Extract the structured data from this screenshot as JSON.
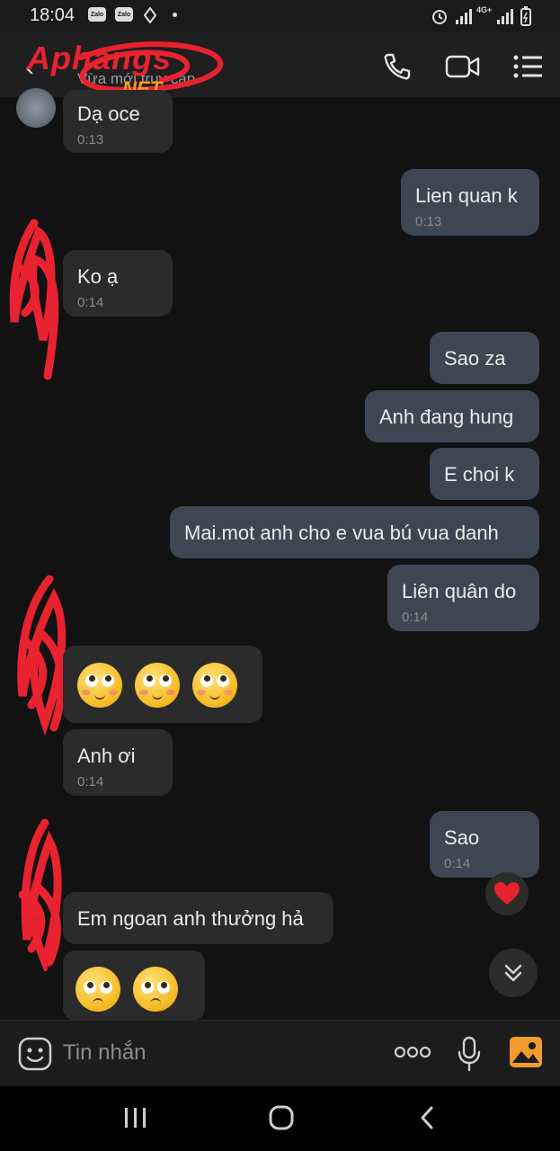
{
  "status_bar": {
    "time": "18:04",
    "zalo_badge": "Zalo",
    "network": "4G+"
  },
  "header": {
    "status_text": "Vừa mới truy cập",
    "watermark_main": "Aphangs",
    "watermark_sub": ".NET"
  },
  "messages": [
    {
      "side": "in",
      "text": "Dạ oce",
      "time": "0:13"
    },
    {
      "side": "out",
      "text": "Lien quan k",
      "time": "0:13"
    },
    {
      "side": "in",
      "text": "Ko ạ",
      "time": "0:14"
    },
    {
      "side": "out",
      "text": "Sao za",
      "time": ""
    },
    {
      "side": "out",
      "text": "Anh đang hung",
      "time": ""
    },
    {
      "side": "out",
      "text": "E choi k",
      "time": ""
    },
    {
      "side": "out",
      "text": "Mai.mot anh cho e vua bú vua danh",
      "time": ""
    },
    {
      "side": "out",
      "text": "Liên quân do",
      "time": "0:14"
    },
    {
      "side": "in",
      "text": "",
      "emoji": "rolling-eyes x3",
      "time": ""
    },
    {
      "side": "in",
      "text": "Anh ơi",
      "time": "0:14"
    },
    {
      "side": "out",
      "text": "Sao",
      "time": "0:14"
    },
    {
      "side": "in",
      "text": "Em ngoan anh thưởng hả",
      "time": ""
    },
    {
      "side": "in",
      "text": "",
      "emoji": "pleading x2",
      "time": ""
    }
  ],
  "input": {
    "placeholder": "Tin nhắn"
  },
  "icons": {
    "call": "phone-icon",
    "video": "video-icon",
    "menu": "list-menu-icon",
    "sticker": "sticker-icon",
    "more": "more-dots-icon",
    "mic": "mic-icon",
    "image": "image-icon",
    "reaction": "heart-icon",
    "scroll": "scroll-down-icon"
  },
  "colors": {
    "bubble_in": "#2b2b2b",
    "bubble_out": "#3d4754",
    "heart": "#e8222f",
    "watermark": "#e8222f",
    "image_icon": "#f29b2e"
  }
}
